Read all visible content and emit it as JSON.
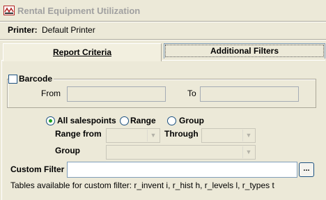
{
  "window": {
    "title": "Rental Equipment Utilization",
    "icon": "app-icon"
  },
  "printer": {
    "label": "Printer:",
    "value": "Default Printer"
  },
  "tabs": [
    {
      "label": "Report Criteria",
      "selected": true
    },
    {
      "label": "Additional Filters",
      "selected": false
    }
  ],
  "barcode": {
    "label": "Barcode",
    "checked": false,
    "from_label": "From",
    "from_value": "",
    "to_label": "To",
    "to_value": ""
  },
  "salespoints": {
    "options": [
      {
        "label": "All salespoints",
        "selected": true
      },
      {
        "label": "Range",
        "selected": false
      },
      {
        "label": "Group",
        "selected": false
      }
    ],
    "range_from_label": "Range from",
    "range_from_value": "",
    "through_label": "Through",
    "through_value": "",
    "group_label": "Group",
    "group_value": ""
  },
  "custom_filter": {
    "label": "Custom Filter",
    "value": "",
    "browse_label": "...",
    "tables_note": "Tables available for custom filter: r_invent i, r_hist h, r_levels l, r_types t"
  },
  "colors": {
    "background": "#ece9d8",
    "radio_dot": "#21a121",
    "title_text": "#a0a0a0"
  }
}
